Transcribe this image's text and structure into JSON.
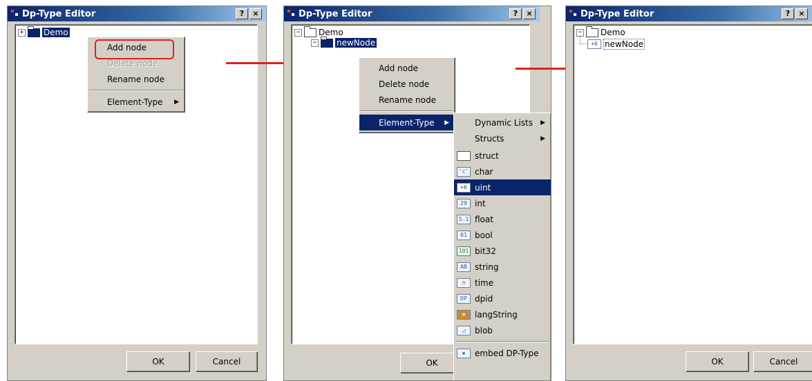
{
  "window_title": "Dp-Type Editor",
  "title_buttons": {
    "help": "?",
    "close": "×"
  },
  "buttons": {
    "ok": "OK",
    "cancel": "Cancel"
  },
  "panel1": {
    "tree": [
      {
        "label": "Demo",
        "expander": "+"
      }
    ],
    "context_menu": [
      {
        "label": "Add node",
        "enabled": true
      },
      {
        "label": "Delete node",
        "enabled": false
      },
      {
        "label": "Rename node",
        "enabled": true
      },
      {
        "label": "Element-Type",
        "enabled": true,
        "submenu": true
      }
    ]
  },
  "panel2": {
    "tree": [
      {
        "label": "Demo",
        "expander": "−"
      },
      {
        "label": "newNode",
        "expander": "−",
        "selected": true
      }
    ],
    "context_menu": [
      {
        "label": "Add node"
      },
      {
        "label": "Delete node"
      },
      {
        "label": "Rename node"
      },
      {
        "label": "Element-Type",
        "highlighted": true,
        "submenu": true
      }
    ],
    "submenu": [
      {
        "label": "Dynamic Lists",
        "submenu": true
      },
      {
        "label": "Structs",
        "submenu": true
      },
      {
        "label": "struct",
        "icon": "struct-folder-icon"
      },
      {
        "label": "char",
        "icon": "char-icon",
        "code": "'c'"
      },
      {
        "label": "uint",
        "icon": "uint-icon",
        "code": "+6",
        "highlighted": true
      },
      {
        "label": "int",
        "icon": "int-icon",
        "code": "29"
      },
      {
        "label": "float",
        "icon": "float-icon",
        "code": "5.1"
      },
      {
        "label": "bool",
        "icon": "bool-icon",
        "code": "01"
      },
      {
        "label": "bit32",
        "icon": "bit32-icon",
        "code": "101"
      },
      {
        "label": "string",
        "icon": "string-icon",
        "code": "AB"
      },
      {
        "label": "time",
        "icon": "time-icon",
        "code": "◷"
      },
      {
        "label": "dpid",
        "icon": "dpid-icon",
        "code": "DP"
      },
      {
        "label": "langString",
        "icon": "langstring-icon",
        "code": "≡"
      },
      {
        "label": "blob",
        "icon": "blob-icon",
        "code": "◿"
      },
      {
        "label": "embed DP-Type",
        "icon": "embed-icon",
        "code": "▪"
      }
    ]
  },
  "panel3": {
    "tree": [
      {
        "label": "Demo",
        "expander": "−"
      },
      {
        "label": "newNode",
        "icon_code": "+6"
      }
    ]
  },
  "colors": {
    "accent": "#0a246a",
    "annotation": "#e0201c",
    "dialog": "#d4d0c8"
  }
}
